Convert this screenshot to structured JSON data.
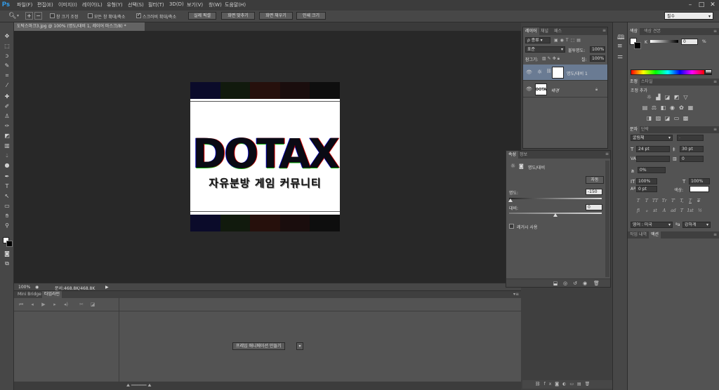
{
  "app": {
    "logo": "Ps"
  },
  "menu": [
    "파일(F)",
    "편집(E)",
    "이미지(I)",
    "레이어(L)",
    "유형(Y)",
    "선택(S)",
    "필터(T)",
    "3D(D)",
    "보기(V)",
    "창(W)",
    "도움말(H)"
  ],
  "options": {
    "check1": "창 크기 조정",
    "check2": "모든 창 확대/축소",
    "check3": "스크러비 확대/축소",
    "btn1": "실제 픽셀",
    "btn2": "화면 맞추기",
    "btn3": "화면 채우기",
    "btn4": "인쇄 크기",
    "workspace": "필수"
  },
  "document": {
    "tab": "도탁스마크3.jpg @ 100% (명도/대비 1, 레이어 마스크/8) *",
    "big_text": "DOTAX",
    "sub_text": "자유분방 게임 커뮤니티",
    "stripe_colors": [
      "#0b0b2a",
      "#111a0d",
      "#26100c",
      "#1a0d0d",
      "#0e0e0e"
    ]
  },
  "status": {
    "zoom": "100%",
    "doc_info": "문서:468.8K/468.8K"
  },
  "bottom_panel": {
    "tabs": [
      "Mini Bridge",
      "타임라인"
    ],
    "create_button": "프레임 애니메이션 만들기"
  },
  "layers": {
    "tabs": [
      "레이어",
      "채널",
      "패스"
    ],
    "kind_filter": "종류",
    "blend_mode": "표준",
    "opacity_label": "불투명도:",
    "opacity": "100%",
    "lock_label": "잠그기:",
    "fill_label": "칠:",
    "fill": "100%",
    "items": [
      {
        "name": "명도/대비 1"
      },
      {
        "name": "배경"
      }
    ],
    "thumb_text": "DOTAX"
  },
  "properties": {
    "tabs": [
      "속성",
      "정보"
    ],
    "title": "명도/대비",
    "auto_button": "자동",
    "brightness_label": "명도:",
    "brightness": "-150",
    "contrast_label": "대비:",
    "contrast": "0",
    "legacy_label": "레거시 사용"
  },
  "color_panel": {
    "tabs": [
      "색상",
      "색상 견본"
    ],
    "k_label": "K",
    "k_value": "0",
    "k_unit": "%"
  },
  "adjustments": {
    "tabs": [
      "조정",
      "스타일"
    ],
    "title": "조정 추가"
  },
  "character": {
    "tabs": [
      "문자",
      "단락"
    ],
    "font": "굴림체",
    "font_style": "-",
    "size": "24 pt",
    "leading": "30 pt",
    "tracking": "0",
    "scale_v": "100%",
    "scale_h": "100%",
    "baseline": "0 pt",
    "color_label": "색상:",
    "glyphs": [
      "T",
      "T",
      "TT",
      "Tr",
      "T'",
      "T,",
      "T",
      "T"
    ],
    "glyphs2": [
      "fi",
      "ℴ",
      "st",
      "A",
      "ad",
      "T",
      "1st",
      "½"
    ],
    "language": "영어 : 미국",
    "aa": "강하게"
  },
  "history": {
    "tabs": [
      "작업 내역",
      "액션"
    ]
  }
}
